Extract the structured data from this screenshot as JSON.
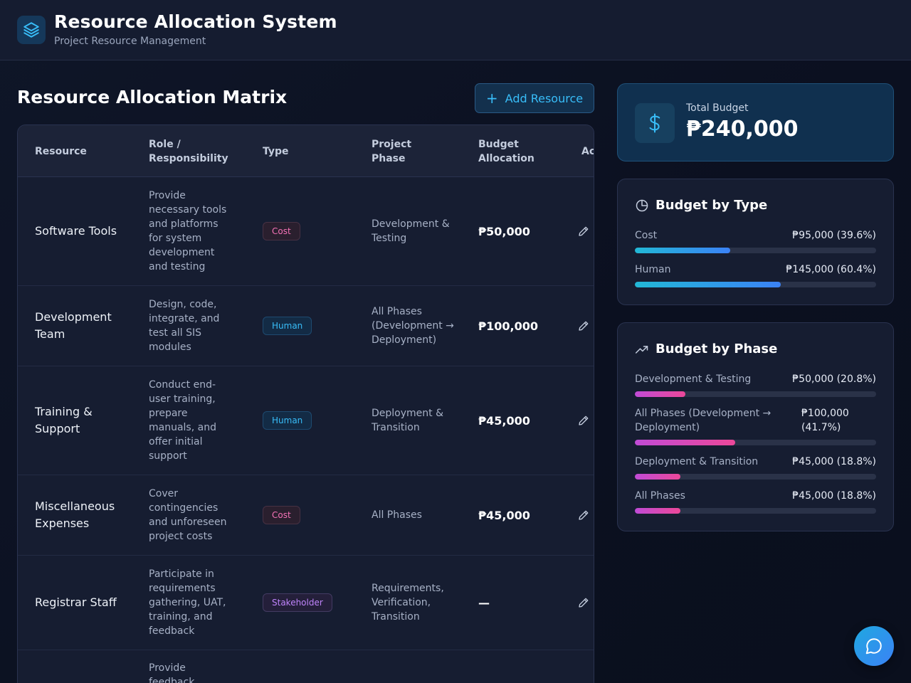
{
  "app": {
    "title": "Resource Allocation System",
    "subtitle": "Project Resource Management"
  },
  "main": {
    "title": "Resource Allocation Matrix",
    "add_button_label": "Add Resource"
  },
  "table": {
    "headers": [
      "Resource",
      "Role / Responsibility",
      "Type",
      "Project Phase",
      "Budget Allocation",
      "Ac"
    ],
    "rows": [
      {
        "resource": "Software Tools",
        "role": "Provide necessary tools and platforms for system development and testing",
        "type": "Cost",
        "phase": "Development & Testing",
        "budget": "₱50,000"
      },
      {
        "resource": "Development Team",
        "role": "Design, code, integrate, and test all SIS modules",
        "type": "Human",
        "phase": "All Phases (Development → Deployment)",
        "budget": "₱100,000"
      },
      {
        "resource": "Training & Support",
        "role": "Conduct end-user training, prepare manuals, and offer initial support",
        "type": "Human",
        "phase": "Deployment & Transition",
        "budget": "₱45,000"
      },
      {
        "resource": "Miscellaneous Expenses",
        "role": "Cover contingencies and unforeseen project costs",
        "type": "Cost",
        "phase": "All Phases",
        "budget": "₱45,000"
      },
      {
        "resource": "Registrar Staff",
        "role": "Participate in requirements gathering, UAT, training, and feedback",
        "type": "Stakeholder",
        "phase": "Requirements, Verification, Transition",
        "budget": "—"
      },
      {
        "resource": "",
        "role": "Provide feedback",
        "type": "",
        "phase": "",
        "budget": ""
      }
    ]
  },
  "summary": {
    "total_label": "Total Budget",
    "total_value": "₱240,000"
  },
  "budget_by_type": {
    "title": "Budget by Type",
    "items": [
      {
        "label": "Cost",
        "value": "₱95,000 (39.6%)",
        "fraction": 0.396
      },
      {
        "label": "Human",
        "value": "₱145,000 (60.4%)",
        "fraction": 0.604
      }
    ]
  },
  "budget_by_phase": {
    "title": "Budget by Phase",
    "items": [
      {
        "label": "Development & Testing",
        "value": "₱50,000 (20.8%)",
        "fraction": 0.208
      },
      {
        "label": "All Phases (Development → Deployment)",
        "value": "₱100,000 (41.7%)",
        "fraction": 0.417
      },
      {
        "label": "Deployment & Transition",
        "value": "₱45,000 (18.8%)",
        "fraction": 0.188
      },
      {
        "label": "All Phases",
        "value": "₱45,000 (18.8%)",
        "fraction": 0.188
      }
    ]
  },
  "colors": {
    "accent": "#38bdf8",
    "cost_badge": "#f472b6",
    "human_badge": "#38bdf8",
    "stakeholder_badge": "#c084fc"
  },
  "icons": {
    "logo": "layers-icon",
    "add": "plus-icon",
    "edit": "pencil-icon",
    "total": "dollar-icon",
    "type_panel": "pie-chart-icon",
    "phase_panel": "trending-up-icon",
    "chat": "chat-bubble-icon"
  }
}
